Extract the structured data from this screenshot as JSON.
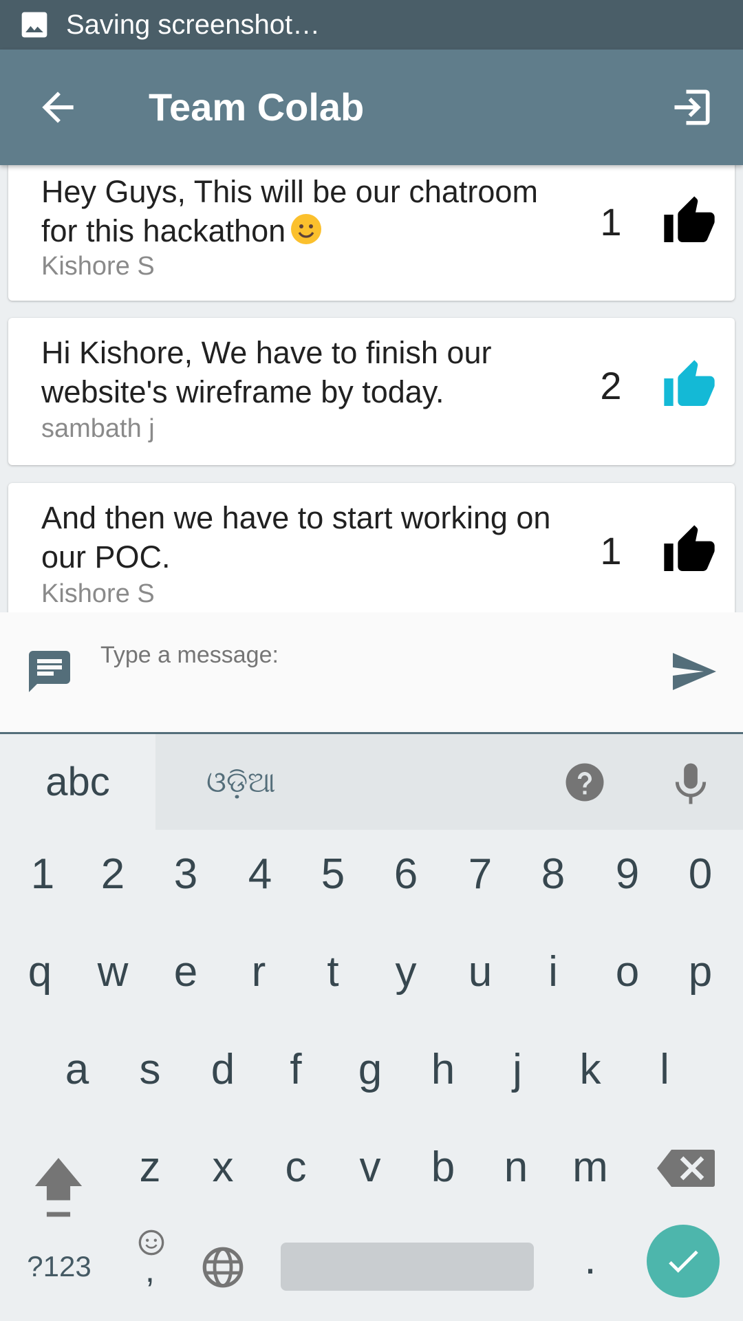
{
  "status_bar": {
    "text": "Saving screenshot…",
    "icon": "image-icon"
  },
  "app_bar": {
    "title": "Team Colab",
    "back_icon": "arrow-back-icon",
    "exit_icon": "exit-icon"
  },
  "messages": [
    {
      "text": "Hey Guys, This will be our chatroom for this hackathon",
      "emoji": "smiley-emoji",
      "author": "Kishore S",
      "likes": "1",
      "liked": false
    },
    {
      "text": "Hi Kishore, We have to finish our website's wireframe by today.",
      "author": "sambath j",
      "likes": "2",
      "liked": true
    },
    {
      "text": "And then we have to start working on our POC.",
      "author": "Kishore S",
      "likes": "1",
      "liked": false
    }
  ],
  "composer": {
    "placeholder": "Type a message:",
    "value": ""
  },
  "keyboard": {
    "mode_abc": "abc",
    "mode_odia": "ଓଡ଼ିଆ",
    "numbers": [
      "1",
      "2",
      "3",
      "4",
      "5",
      "6",
      "7",
      "8",
      "9",
      "0"
    ],
    "row1": [
      "q",
      "w",
      "e",
      "r",
      "t",
      "y",
      "u",
      "i",
      "o",
      "p"
    ],
    "row2": [
      "a",
      "s",
      "d",
      "f",
      "g",
      "h",
      "j",
      "k",
      "l"
    ],
    "row3": [
      "z",
      "x",
      "c",
      "v",
      "b",
      "n",
      "m"
    ],
    "symbols_key": "?123",
    "emoji_comma_key": ",",
    "period_key": "."
  },
  "colors": {
    "status_bar": "#4a5e68",
    "app_bar": "#607d8b",
    "like_active": "#14b9d6",
    "like_inactive": "#000000",
    "enter_key": "#4db6ac"
  }
}
